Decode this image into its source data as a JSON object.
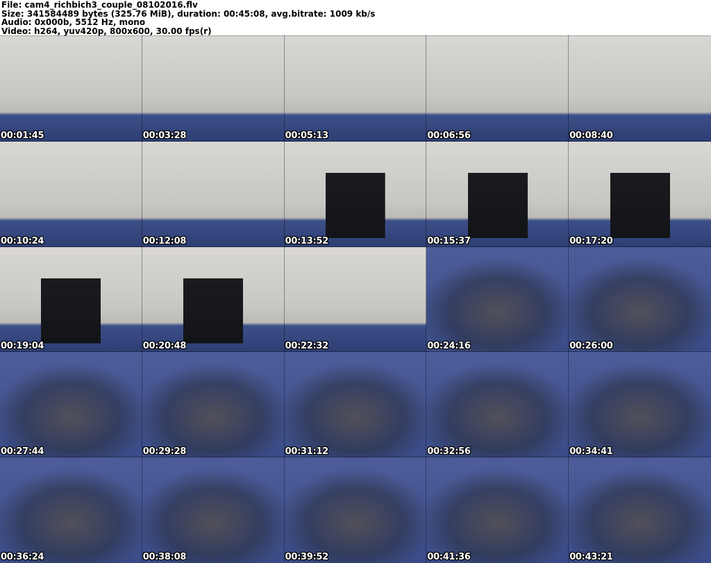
{
  "header": {
    "file_line": "File: cam4_richbich3_couple_08102016.flv",
    "size_line": "Size: 341584489 bytes (325.76 MiB), duration: 00:45:08, avg.bitrate: 1009 kb/s",
    "audio_line": "Audio: 0x000b, 5512 Hz, mono",
    "video_line": "Video: h264, yuv420p, 800x600, 30.00 fps(r)"
  },
  "grid": {
    "columns": 5,
    "rows": 5,
    "thumbnails": [
      {
        "timestamp": "00:01:45",
        "scene": "room"
      },
      {
        "timestamp": "00:03:28",
        "scene": "room"
      },
      {
        "timestamp": "00:05:13",
        "scene": "room"
      },
      {
        "timestamp": "00:06:56",
        "scene": "room"
      },
      {
        "timestamp": "00:08:40",
        "scene": "room"
      },
      {
        "timestamp": "00:10:24",
        "scene": "room"
      },
      {
        "timestamp": "00:12:08",
        "scene": "room"
      },
      {
        "timestamp": "00:13:52",
        "scene": "chair"
      },
      {
        "timestamp": "00:15:37",
        "scene": "chair"
      },
      {
        "timestamp": "00:17:20",
        "scene": "chair"
      },
      {
        "timestamp": "00:19:04",
        "scene": "chair"
      },
      {
        "timestamp": "00:20:48",
        "scene": "chair"
      },
      {
        "timestamp": "00:22:32",
        "scene": "room"
      },
      {
        "timestamp": "00:24:16",
        "scene": "closeup"
      },
      {
        "timestamp": "00:26:00",
        "scene": "closeup"
      },
      {
        "timestamp": "00:27:44",
        "scene": "closeup"
      },
      {
        "timestamp": "00:29:28",
        "scene": "closeup"
      },
      {
        "timestamp": "00:31:12",
        "scene": "closeup"
      },
      {
        "timestamp": "00:32:56",
        "scene": "closeup"
      },
      {
        "timestamp": "00:34:41",
        "scene": "closeup"
      },
      {
        "timestamp": "00:36:24",
        "scene": "closeup"
      },
      {
        "timestamp": "00:38:08",
        "scene": "closeup"
      },
      {
        "timestamp": "00:39:52",
        "scene": "closeup"
      },
      {
        "timestamp": "00:41:36",
        "scene": "closeup"
      },
      {
        "timestamp": "00:43:21",
        "scene": "closeup"
      }
    ]
  },
  "colors": {
    "header_bg": "#ffffff",
    "header_text": "#000000",
    "timestamp_text": "#ffffff",
    "timestamp_outline": "#000000",
    "wall": "#c9c7c3",
    "carpet": "#3c4f88",
    "chair": "#1a1b1f"
  }
}
